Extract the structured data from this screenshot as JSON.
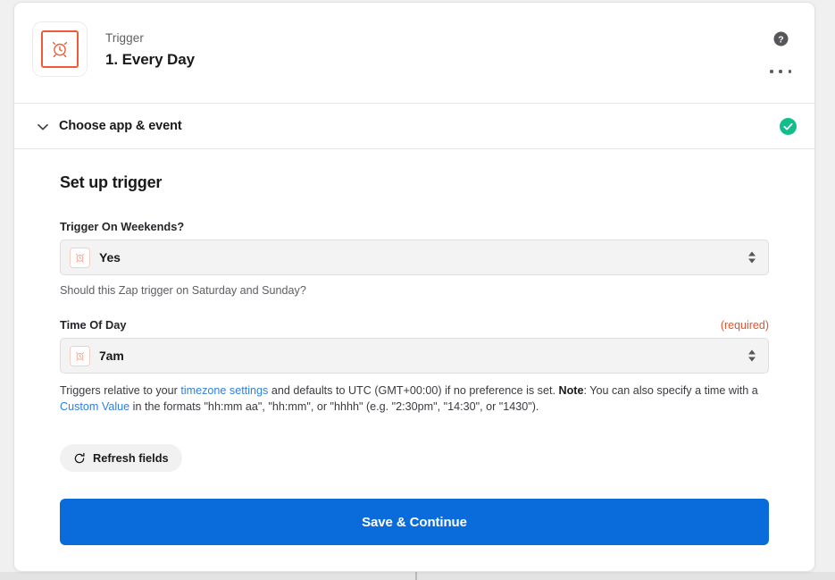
{
  "step_header": {
    "kicker": "Trigger",
    "title": "1. Every Day",
    "app_icon": "alarm-clock-icon",
    "help_icon": "help-circle-icon",
    "more_icon": "more-options-icon"
  },
  "sections": {
    "choose_app_event": {
      "label": "Choose app & event",
      "chevron_icon": "chevron-down-icon",
      "status_icon": "check-circle-icon",
      "status_color": "#12bd8c"
    }
  },
  "setup": {
    "title": "Set up trigger",
    "fields": [
      {
        "label": "Trigger On Weekends?",
        "required_label": "",
        "value": "Yes",
        "icon": "alarm-clock-icon",
        "hint": "Should this Zap trigger on Saturday and Sunday?"
      },
      {
        "label": "Time Of Day",
        "required_label": "(required)",
        "value": "7am",
        "icon": "alarm-clock-icon",
        "hint": ""
      }
    ],
    "time_help": {
      "part1": "Triggers relative to your ",
      "link1": "timezone settings",
      "part2": " and defaults to UTC (GMT+00:00) if no preference is set. ",
      "note_label": "Note",
      "part3": ": You can also specify a time with a ",
      "link2": "Custom Value",
      "part4": " in the formats \"hh:mm aa\", \"hh:mm\", or \"hhhh\" (e.g. \"2:30pm\", \"14:30\", or \"1430\")."
    },
    "refresh_button": {
      "label": "Refresh fields",
      "icon": "refresh-icon"
    },
    "save_button": {
      "label": "Save & Continue",
      "color": "#0a6cdb"
    }
  },
  "theme": {
    "accent_orange": "#ef5b36",
    "required_orange": "#e0542e",
    "link_blue": "#2f80e0",
    "success_green": "#12bd8c",
    "page_bg": "#f0f0f1"
  }
}
